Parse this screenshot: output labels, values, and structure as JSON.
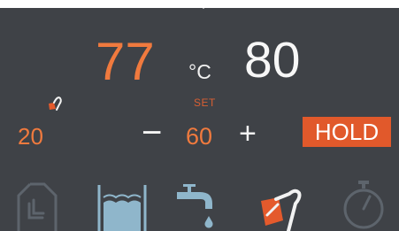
{
  "display": {
    "current_temperature": "77",
    "unit": "°C",
    "target_temperature": "80",
    "set_label": "SET",
    "set_value": "60",
    "left_value": "20",
    "decrease_symbol": "−",
    "increase_symbol": "+",
    "hold_label": "HOLD"
  },
  "icons": {
    "probe_small": "thermometer-probe-icon",
    "mode_1": "slow-cook-icon",
    "mode_2": "water-bath-icon",
    "mode_3": "tap-water-icon",
    "mode_4": "probe-mode-icon",
    "mode_5": "timer-icon"
  },
  "colors": {
    "background": "#3f4247",
    "accent": "#f07a3e",
    "hold_button": "#e1592b",
    "inactive_icon": "#5d646c",
    "water_icon": "#8fb6cb"
  }
}
